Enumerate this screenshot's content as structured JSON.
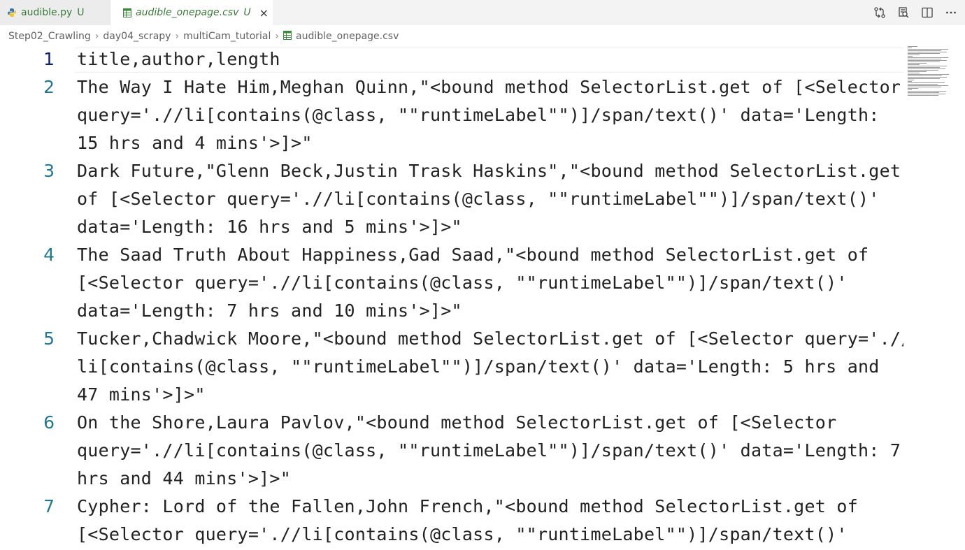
{
  "tabs": [
    {
      "name": "audible.py",
      "status": "U",
      "icon": "python-icon",
      "active": false
    },
    {
      "name": "audible_onepage.csv",
      "status": "U",
      "icon": "csv-icon",
      "active": true,
      "close": "×"
    }
  ],
  "breadcrumb": [
    "Step02_Crawling",
    "day04_scrapy",
    "multiCam_tutorial",
    "audible_onepage.csv"
  ],
  "editor": {
    "current_line": 1,
    "lines": [
      {
        "number": "1",
        "rows": [
          "title,author,length"
        ]
      },
      {
        "number": "2",
        "rows": [
          "The Way I Hate Him,Meghan Quinn,\"<bound method SelectorList.get of [<Selector",
          "query='.//li[contains(@class, \"\"runtimeLabel\"\")]/span/text()' data='Length:",
          "15 hrs and 4 mins'>]>\""
        ]
      },
      {
        "number": "3",
        "rows": [
          "Dark Future,\"Glenn Beck,Justin Trask Haskins\",\"<bound method SelectorList.get",
          "of [<Selector query='.//li[contains(@class, \"\"runtimeLabel\"\")]/span/text()'",
          "data='Length: 16 hrs and 5 mins'>]>\""
        ]
      },
      {
        "number": "4",
        "rows": [
          "The Saad Truth About Happiness,Gad Saad,\"<bound method SelectorList.get of",
          "[<Selector query='.//li[contains(@class, \"\"runtimeLabel\"\")]/span/text()'",
          "data='Length: 7 hrs and 10 mins'>]>\""
        ]
      },
      {
        "number": "5",
        "rows": [
          "Tucker,Chadwick Moore,\"<bound method SelectorList.get of [<Selector query='.//",
          "li[contains(@class, \"\"runtimeLabel\"\")]/span/text()' data='Length: 5 hrs and",
          "47 mins'>]>\""
        ]
      },
      {
        "number": "6",
        "rows": [
          "On the Shore,Laura Pavlov,\"<bound method SelectorList.get of [<Selector",
          "query='.//li[contains(@class, \"\"runtimeLabel\"\")]/span/text()' data='Length: 7",
          "hrs and 44 mins'>]>\""
        ]
      },
      {
        "number": "7",
        "rows": [
          "Cypher: Lord of the Fallen,John French,\"<bound method SelectorList.get of",
          "[<Selector query='.//li[contains(@class, \"\"runtimeLabel\"\")]/span/text()'"
        ]
      }
    ]
  },
  "actions": [
    "compare-changes-icon",
    "open-preview-icon",
    "split-editor-icon",
    "more-actions-icon"
  ],
  "colors": {
    "line_number": "#237893",
    "line_number_active": "#0b216f",
    "tab_modified": "#3c7a3c",
    "text": "#222222"
  }
}
